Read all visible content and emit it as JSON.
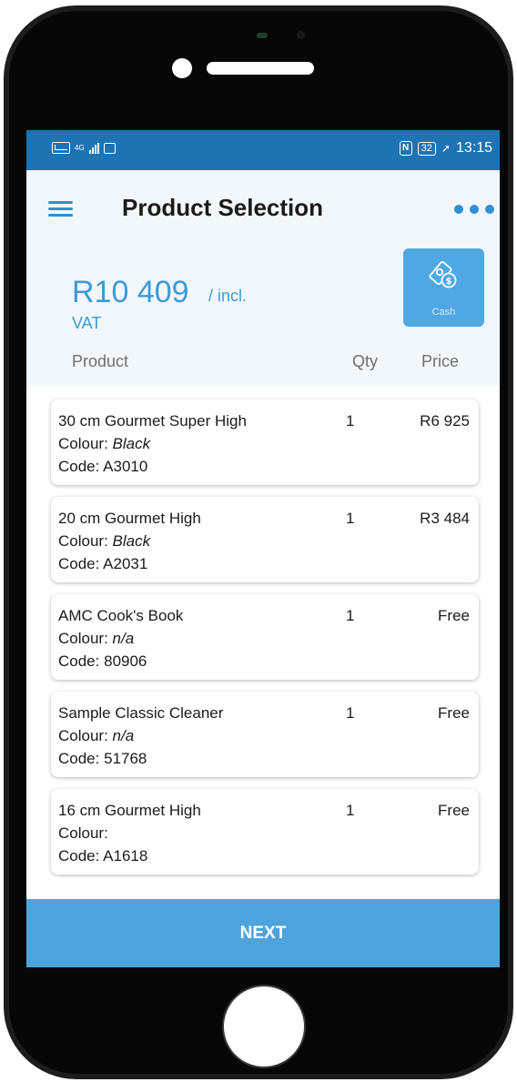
{
  "status_bar": {
    "network_label": "4G",
    "battery_level": "32",
    "time": "13:15"
  },
  "header": {
    "title": "Product Selection",
    "menu_icon": "hamburger-menu-icon",
    "more_icon": "more-options-icon"
  },
  "summary": {
    "total": "R10 409",
    "total_suffix": "/ incl.",
    "vat_label": "VAT",
    "payment_button": {
      "label": "Cash",
      "icon": "cash-icon"
    }
  },
  "columns": {
    "product": "Product",
    "qty": "Qty",
    "price": "Price"
  },
  "colour_label": "Colour:",
  "code_label": "Code:",
  "items": [
    {
      "name": "30 cm Gourmet Super High",
      "colour": "Black",
      "code": "A3010",
      "qty": "1",
      "price": "R6 925"
    },
    {
      "name": "20 cm Gourmet High",
      "colour": "Black",
      "code": "A2031",
      "qty": "1",
      "price": "R3 484"
    },
    {
      "name": "AMC Cook's Book",
      "colour": "n/a",
      "code": "80906",
      "qty": "1",
      "price": "Free"
    },
    {
      "name": "Sample Classic Cleaner",
      "colour": "n/a",
      "code": "51768",
      "qty": "1",
      "price": "Free"
    },
    {
      "name": "16 cm Gourmet High",
      "colour": "",
      "code": "A1618",
      "qty": "1",
      "price": "Free"
    }
  ],
  "footer": {
    "next_label": "NEXT"
  },
  "colors": {
    "accent": "#3d9ad9",
    "status_bar": "#1e73b3",
    "button": "#4fa3dd"
  }
}
